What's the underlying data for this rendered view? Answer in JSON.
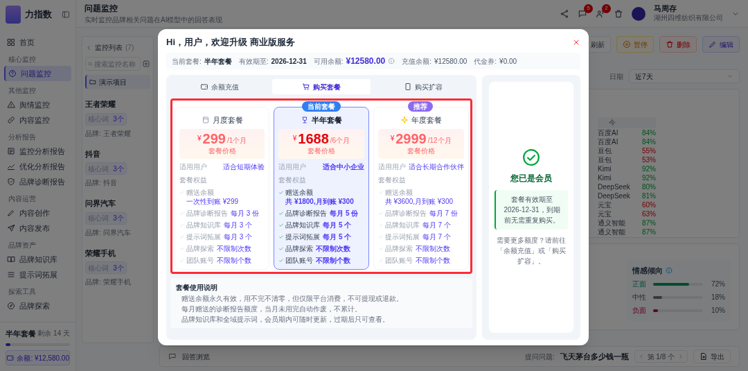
{
  "sidebar": {
    "logo_text": "力指数",
    "sections": [
      {
        "items": [
          {
            "label": "首页",
            "selected": false
          }
        ]
      },
      {
        "title": "核心监控",
        "items": [
          {
            "label": "问题监控",
            "selected": true
          }
        ]
      },
      {
        "title": "其他监控",
        "items": [
          {
            "label": "舆情监控",
            "selected": false
          },
          {
            "label": "内容监控",
            "selected": false
          }
        ]
      },
      {
        "title": "分析报告",
        "items": [
          {
            "label": "监控分析报告",
            "selected": false
          },
          {
            "label": "优化分析报告",
            "selected": false
          },
          {
            "label": "品牌诊断报告",
            "selected": false
          }
        ]
      },
      {
        "title": "内容运营",
        "items": [
          {
            "label": "内容创作",
            "selected": false
          },
          {
            "label": "内容发布",
            "selected": false
          }
        ]
      },
      {
        "title": "品牌资产",
        "items": [
          {
            "label": "品牌知识库",
            "selected": false
          },
          {
            "label": "提示词拓展",
            "selected": false
          }
        ]
      },
      {
        "title": "探索工具",
        "items": [
          {
            "label": "品牌探索",
            "selected": false
          }
        ]
      }
    ],
    "plan": {
      "name": "半年套餐",
      "days_left": "剩余 14 天",
      "level": 0.08,
      "balance": "余额: ¥12,580.00"
    }
  },
  "header": {
    "title": "问题监控",
    "subtitle": "实时监控品牌相关问题在AI模型中的回答表现",
    "badges": [
      "5",
      "2"
    ],
    "user": {
      "name": "马周存",
      "company": "湖州四维纺织有限公司"
    }
  },
  "monitor_list": {
    "title": "监控列表",
    "count": "(7)",
    "search_placeholder": "搜索监控名称",
    "folder": "演示项目",
    "items": [
      {
        "name": "王者荣耀",
        "chip_label": "核心词",
        "chip_value": "3个",
        "brand": "品牌: 王者荣耀"
      },
      {
        "name": "抖音",
        "chip_label": "核心词",
        "chip_value": "3个",
        "brand": "品牌: 抖音"
      },
      {
        "name": "问界汽车",
        "chip_label": "核心词",
        "chip_value": "3个",
        "brand": "品牌: 问界汽车"
      },
      {
        "name": "荣耀手机",
        "chip_label": "核心词",
        "chip_value": "3个",
        "brand": "品牌: 荣耀手机"
      }
    ]
  },
  "toolbar": [
    {
      "label": "刷新",
      "kind": "neutral"
    },
    {
      "label": "暂停",
      "kind": "warning"
    },
    {
      "label": "删除",
      "kind": "danger"
    },
    {
      "label": "编辑",
      "kind": "primary"
    }
  ],
  "date_filter": {
    "label": "日期",
    "value": "近7天"
  },
  "table_fragment": {
    "header": "今",
    "rows": [
      {
        "name": "百度AI",
        "value": "84%",
        "kind": "good"
      },
      {
        "name": "百度AI",
        "value": "84%",
        "kind": "good"
      },
      {
        "name": "豆包",
        "value": "55%",
        "kind": "bad"
      },
      {
        "name": "豆包",
        "value": "53%",
        "kind": "bad"
      },
      {
        "name": "Kimi",
        "value": "92%",
        "kind": "good"
      },
      {
        "name": "Kimi",
        "value": "92%",
        "kind": "good"
      },
      {
        "name": "DeepSeek",
        "value": "80%",
        "kind": "good"
      },
      {
        "name": "DeepSeek",
        "value": "81%",
        "kind": "good"
      },
      {
        "name": "元宝",
        "value": "60%",
        "kind": "bad"
      },
      {
        "name": "元宝",
        "value": "63%",
        "kind": "bad"
      },
      {
        "name": "通义智能",
        "value": "87%",
        "kind": "good"
      },
      {
        "name": "通义智能",
        "value": "87%",
        "kind": "good"
      }
    ]
  },
  "sentiment": {
    "title": "情感倾向",
    "rows": [
      {
        "label": "正面",
        "level": 0.72,
        "reading": "72%",
        "kind": "positive"
      },
      {
        "label": "中性",
        "level": 0.18,
        "reading": "18%",
        "kind": "neutral"
      },
      {
        "label": "负面",
        "level": 0.1,
        "reading": "10%",
        "kind": "negative"
      }
    ]
  },
  "bottom_bar": {
    "title": "回答浏览",
    "question_label": "提问问题:",
    "question": "飞天茅台多少钱一瓶",
    "pager": "第 1/8 个",
    "export": "导出"
  },
  "modal": {
    "title": "Hi，用户，欢迎升级 商业版服务",
    "account": [
      {
        "kind": "primary",
        "label": "当前套餐:",
        "value": "半年套餐"
      },
      {
        "kind": "primary",
        "label": "有效期至:",
        "value": "2026-12-31"
      },
      {
        "kind": "balance",
        "label": "可用余额:",
        "value": "¥12580.00"
      },
      {
        "kind": "secondary",
        "label": "充值余额:",
        "value": "¥12580.00"
      },
      {
        "kind": "secondary",
        "label": "代金券:",
        "value": "¥0.00"
      }
    ],
    "tabs": [
      {
        "label": "余额充值",
        "selected": false
      },
      {
        "label": "购买套餐",
        "selected": true
      },
      {
        "label": "购买扩容",
        "selected": false
      }
    ],
    "plans": [
      {
        "name": "月度套餐",
        "currency": "¥",
        "price": "299",
        "period": "/1个月",
        "price_label": "套餐价格",
        "audience_label": "适用用户",
        "audience": "适合短期体验",
        "benefits_title": "套餐权益",
        "selected": false,
        "benefits": [
          {
            "label": "赠送余额",
            "value": "一次性到账 ¥299"
          },
          {
            "label": "品牌诊断报告",
            "value": "每月 3 份"
          },
          {
            "label": "品牌知识库",
            "value": "每月 3 个"
          },
          {
            "label": "提示词拓展",
            "value": "每月 3 个"
          },
          {
            "label": "品牌探索",
            "value": "不限制次数"
          },
          {
            "label": "团队账号",
            "value": "不限制个数"
          }
        ]
      },
      {
        "name": "半年套餐",
        "badge": {
          "text": "当前套餐",
          "color": "#2f7ff0"
        },
        "currency": "¥",
        "price": "1688",
        "period": "/6个月",
        "price_label": "套餐价格",
        "audience_label": "适用用户",
        "audience": "适合中小企业",
        "benefits_title": "套餐权益",
        "selected": true,
        "benefits": [
          {
            "label": "赠送余额",
            "value": "共 ¥1800,月到账 ¥300"
          },
          {
            "label": "品牌诊断报告",
            "value": "每月 5 份"
          },
          {
            "label": "品牌知识库",
            "value": "每月 5 个"
          },
          {
            "label": "提示词拓展",
            "value": "每月 5 个"
          },
          {
            "label": "品牌探索",
            "value": "不限制次数"
          },
          {
            "label": "团队账号",
            "value": "不限制个数"
          }
        ]
      },
      {
        "name": "年度套餐",
        "badge": {
          "text": "推荐",
          "color": "#8b6cf0"
        },
        "currency": "¥",
        "price": "2999",
        "period": "/12个月",
        "price_label": "套餐价格",
        "audience_label": "适用用户",
        "audience": "适合长期合作伙伴",
        "benefits_title": "套餐权益",
        "selected": false,
        "benefits": [
          {
            "label": "赠送余额",
            "value": "共 ¥3600,月到账 ¥300"
          },
          {
            "label": "品牌诊断报告",
            "value": "每月 7 份"
          },
          {
            "label": "品牌知识库",
            "value": "每月 7 个"
          },
          {
            "label": "提示词拓展",
            "value": "每月 7 个"
          },
          {
            "label": "品牌探索",
            "value": "不限制次数"
          },
          {
            "label": "团队账号",
            "value": "不限制个数"
          }
        ]
      }
    ],
    "notes": {
      "title": "套餐使用说明",
      "items": [
        "赠送余额永久有效，用不完不清零，但仅限平台消费，不可提现或退款。",
        "每月赠送的诊断报告额度，当月未用完自动作废，不累计。",
        "品牌知识库和全域提示词，会员期内可随时更新，过期后只可查看。"
      ]
    },
    "member": {
      "title": "您已是会员",
      "message": "套餐有效期至 2026-12-31，到期前无需重复购买。",
      "hint": "需要更多额度？请前往「余额充值」或「购买扩容」。"
    }
  }
}
